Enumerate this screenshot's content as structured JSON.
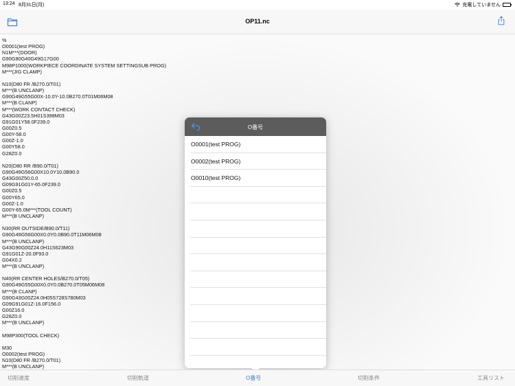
{
  "status_bar": {
    "time": "13:24",
    "date": "8月31日(月)",
    "charging": "充電していません"
  },
  "nav": {
    "title": "OP11.nc",
    "folder_icon": "folder-icon",
    "share_icon": "share-icon"
  },
  "code_lines": [
    "%",
    "O0001(test PROG)",
    "N1M***(DOOR)",
    "G90G80G40G49G17G00",
    "M98P1000(WORKPIECE COORDINATE SYSTEM SETTINGSUB PROG)",
    "M***(JIG CLAMP)",
    "",
    "N10(D80 FR /B270.0/T01)",
    "M***(B UNCLANP)",
    "G90G49G55G00X-10.0Y-10.0B270.0T01M06M08",
    "M***(B CLANP)",
    "M***(WORK CONTACT CHECK)",
    "G43G00Z23.5H01S398M03",
    "G91G01Y58.0F239.0",
    "G00Z0.5",
    "G00Y-58.0",
    "G00Z-1.0",
    "G00Y58.0",
    "G28Z0.0",
    "",
    "N20(D80 RR /B90.0/T01)",
    "G90G49G56G00X10.0Y10.0B90.0",
    "G43G00Z50.0.0",
    "G09G91G01Y-65.0F239.0",
    "G00Z0.5",
    "G00Y65.0",
    "G00Z-1.0",
    "G00Y-65.0M***(TOOL COUNT)",
    "M***(B UNCLANP)",
    "",
    "N30(RR OUTSIDE/B90.0/T11)",
    "G90G49G56G00X0.0Y0.0B90.0T11M06M08",
    "M***(B UNCLANP)",
    "G43G90G00Z24.0H11S623M03",
    "G91G01Z-20.0F93.0",
    "G04X0.2",
    "M***(B UNCLANP)",
    "",
    "N40(RR CENTER HOLES/B270.0/T05)",
    "G90G49G55G00X0.0Y0.0B270.0T05M06M08",
    "M***(B CLANP)",
    "G90G43G00Z24.0H05S728S780M03",
    "G09G91G01Z-16.0F156.0",
    "G00Z16.0",
    "G28Z0.0",
    "M***(B UNCLANP)",
    "",
    "M98P300(TOOL CHECK)",
    "",
    "M30",
    "O0002(test PROG)",
    "N10(D80 FR /B270.0/T01)",
    "M***(B UNCLANP)"
  ],
  "popover": {
    "title": "O番号",
    "back_icon": "back-arrow-icon",
    "items": [
      "O0001(test PROG)",
      "O0002(test PROG)",
      "O0010(test PROG)"
    ]
  },
  "tabs": [
    {
      "label": "切削速度",
      "active": false
    },
    {
      "label": "切削軌道",
      "active": false
    },
    {
      "label": "O番号",
      "active": true
    },
    {
      "label": "切削条件",
      "active": false
    },
    {
      "label": "工具リスト",
      "active": false
    }
  ],
  "colors": {
    "accent": "#3b7ddd",
    "popover_header": "#5c5c5c",
    "tab_inactive": "#8a8a8a"
  }
}
